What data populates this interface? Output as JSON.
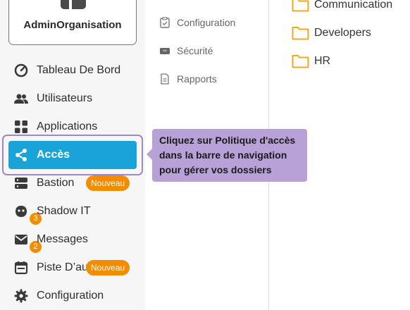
{
  "org": {
    "name": "AdminOrganisation"
  },
  "sidebar": {
    "items": [
      {
        "label": "Tableau De Bord",
        "icon": "dashboard-icon"
      },
      {
        "label": "Utilisateurs",
        "icon": "users-icon"
      },
      {
        "label": "Applications",
        "icon": "apps-grid-icon"
      },
      {
        "label": "Accès",
        "icon": "share-icon",
        "active": true
      },
      {
        "label": "Bastion",
        "icon": "server-icon",
        "badge": "Nouveau"
      },
      {
        "label": "Shadow IT",
        "icon": "shadow-it-icon",
        "count": "3"
      },
      {
        "label": "Messages",
        "icon": "mail-icon",
        "count": "2"
      },
      {
        "label": "Piste D’au",
        "icon": "calendar-icon",
        "badge": "Nouveau"
      },
      {
        "label": "Configuration",
        "icon": "gear-icon"
      }
    ]
  },
  "submenu": {
    "items": [
      {
        "label": "Configuration",
        "icon": "clipboard-check-icon"
      },
      {
        "label": "Sécurité",
        "icon": "password-icon"
      },
      {
        "label": "Rapports",
        "icon": "document-icon"
      }
    ]
  },
  "folders": [
    {
      "label": "Communication"
    },
    {
      "label": "Developers"
    },
    {
      "label": "HR"
    }
  ],
  "tooltip": {
    "line1": "Cliquez sur Politique d'accès",
    "line2": "dans la barre de navigation",
    "line3": "pour gérer vos dossiers"
  },
  "colors": {
    "accent": "#1aa3d6",
    "highlight": "#9e87c6",
    "tooltip_bg": "#b7a1d6",
    "badge": "#f28c00",
    "folder": "#f0a81c"
  }
}
